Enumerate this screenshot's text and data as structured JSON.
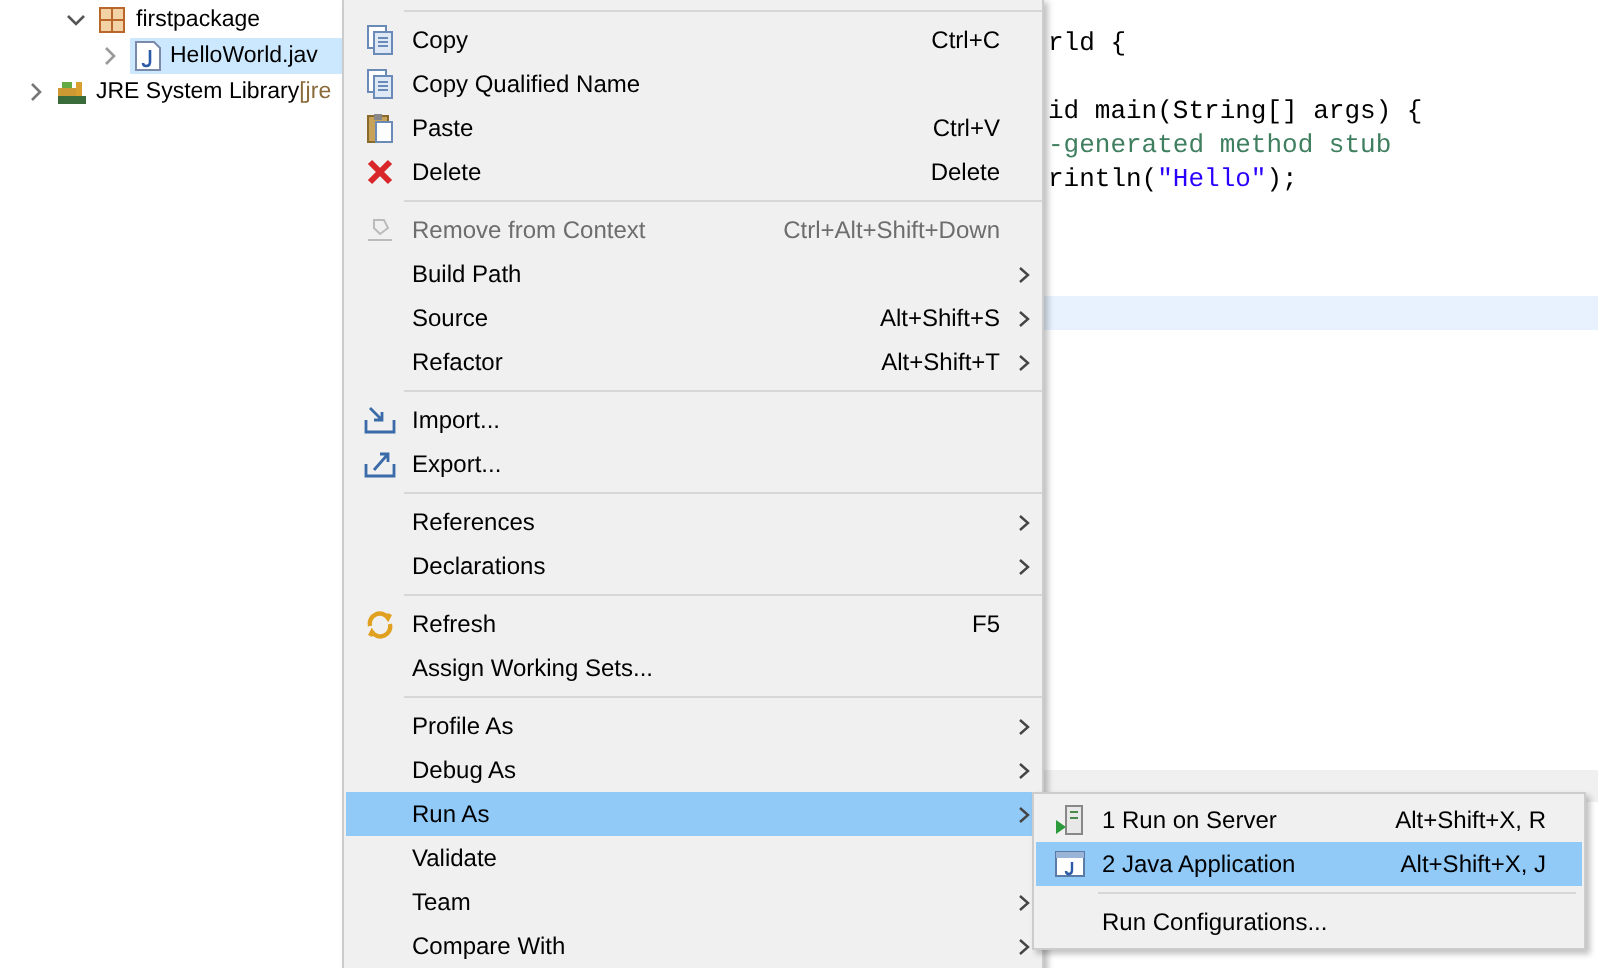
{
  "project_tree": [
    {
      "label": "firstpackage",
      "kind": "package",
      "expanded": true,
      "selected": false,
      "children": [
        {
          "label": "HelloWorld.jav",
          "kind": "java-file",
          "expanded": false,
          "selected": true
        }
      ]
    },
    {
      "label": "JRE System Library",
      "decoration": "[jre",
      "kind": "library",
      "expanded": false,
      "selected": false
    }
  ],
  "editor": {
    "lines": [
      {
        "text": "rld {",
        "kind": "code"
      },
      {
        "kind": "blank"
      },
      {
        "text": "id main(String[] args) {",
        "kind": "code"
      },
      {
        "text": "-generated method stub",
        "kind": "comment"
      },
      {
        "text": "rintln(",
        "string": "\"Hello\"",
        "after": ");",
        "kind": "code"
      }
    ]
  },
  "context_menu": {
    "items": [
      {
        "kind": "separator"
      },
      {
        "kind": "item",
        "label": "Copy",
        "shortcut": "Ctrl+C",
        "submenu": false,
        "disabled": false,
        "selected": false
      },
      {
        "kind": "item",
        "label": "Copy Qualified Name",
        "submenu": false,
        "disabled": false,
        "selected": false
      },
      {
        "kind": "item",
        "label": "Paste",
        "shortcut": "Ctrl+V",
        "submenu": false,
        "disabled": false,
        "selected": false
      },
      {
        "kind": "item",
        "label": "Delete",
        "shortcut": "Delete",
        "submenu": false,
        "disabled": false,
        "selected": false
      },
      {
        "kind": "separator"
      },
      {
        "kind": "item",
        "label": "Remove from Context",
        "shortcut": "Ctrl+Alt+Shift+Down",
        "submenu": false,
        "disabled": true,
        "selected": false
      },
      {
        "kind": "item",
        "label": "Build Path",
        "submenu": true,
        "disabled": false,
        "selected": false
      },
      {
        "kind": "item",
        "label": "Source",
        "shortcut": "Alt+Shift+S",
        "submenu": true,
        "disabled": false,
        "selected": false
      },
      {
        "kind": "item",
        "label": "Refactor",
        "shortcut": "Alt+Shift+T",
        "submenu": true,
        "disabled": false,
        "selected": false
      },
      {
        "kind": "separator"
      },
      {
        "kind": "item",
        "label": "Import...",
        "submenu": false,
        "disabled": false,
        "selected": false
      },
      {
        "kind": "item",
        "label": "Export...",
        "submenu": false,
        "disabled": false,
        "selected": false
      },
      {
        "kind": "separator"
      },
      {
        "kind": "item",
        "label": "References",
        "submenu": true,
        "disabled": false,
        "selected": false
      },
      {
        "kind": "item",
        "label": "Declarations",
        "submenu": true,
        "disabled": false,
        "selected": false
      },
      {
        "kind": "separator"
      },
      {
        "kind": "item",
        "label": "Refresh",
        "shortcut": "F5",
        "submenu": false,
        "disabled": false,
        "selected": false
      },
      {
        "kind": "item",
        "label": "Assign Working Sets...",
        "submenu": false,
        "disabled": false,
        "selected": false
      },
      {
        "kind": "separator"
      },
      {
        "kind": "item",
        "label": "Profile As",
        "submenu": true,
        "disabled": false,
        "selected": false
      },
      {
        "kind": "item",
        "label": "Debug As",
        "submenu": true,
        "disabled": false,
        "selected": false
      },
      {
        "kind": "item",
        "label": "Run As",
        "submenu": true,
        "disabled": false,
        "selected": true
      },
      {
        "kind": "item",
        "label": "Validate",
        "submenu": false,
        "disabled": false,
        "selected": false
      },
      {
        "kind": "item",
        "label": "Team",
        "submenu": true,
        "disabled": false,
        "selected": false
      },
      {
        "kind": "item",
        "label": "Compare With",
        "submenu": true,
        "disabled": false,
        "selected": false
      }
    ]
  },
  "run_as_submenu": {
    "items": [
      {
        "kind": "item",
        "label": "1 Run on Server",
        "shortcut": "Alt+Shift+X, R",
        "selected": false
      },
      {
        "kind": "item",
        "label": "2 Java Application",
        "shortcut": "Alt+Shift+X, J",
        "selected": true
      },
      {
        "kind": "separator"
      },
      {
        "kind": "item",
        "label": "Run Configurations...",
        "selected": false
      }
    ]
  }
}
